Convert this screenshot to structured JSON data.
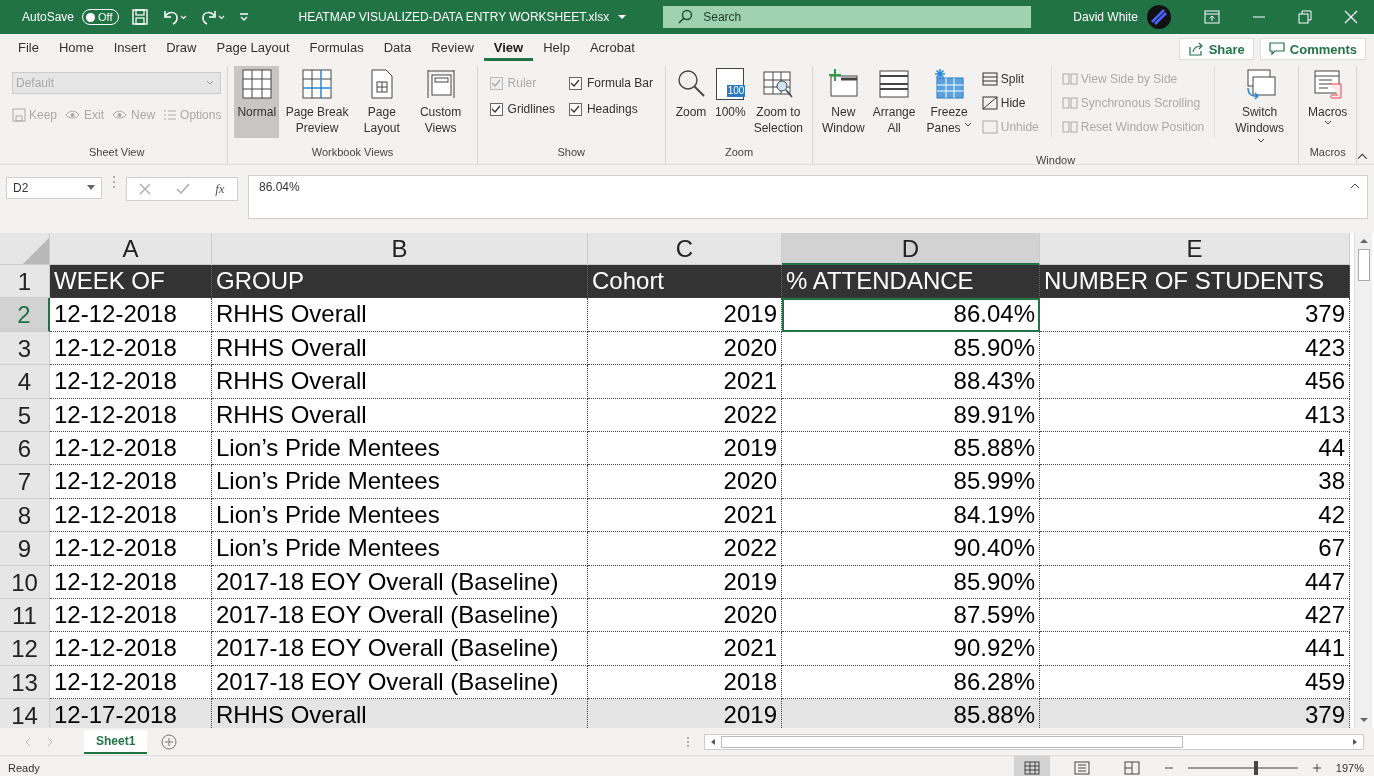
{
  "title_bar": {
    "autosave_label": "AutoSave",
    "autosave_state": "Off",
    "autosave_on": false,
    "document_title": "HEATMAP VISUALIZED-DATA ENTRY WORKSHEET.xlsx",
    "search": {
      "placeholder": "Search"
    },
    "user_name": "David White"
  },
  "menu_tabs": [
    {
      "label": "File",
      "selected": false
    },
    {
      "label": "Home",
      "selected": false
    },
    {
      "label": "Insert",
      "selected": false
    },
    {
      "label": "Draw",
      "selected": false
    },
    {
      "label": "Page Layout",
      "selected": false
    },
    {
      "label": "Formulas",
      "selected": false
    },
    {
      "label": "Data",
      "selected": false
    },
    {
      "label": "Review",
      "selected": false
    },
    {
      "label": "View",
      "selected": true
    },
    {
      "label": "Help",
      "selected": false
    },
    {
      "label": "Acrobat",
      "selected": false
    }
  ],
  "share_button": "Share",
  "comments_button": "Comments",
  "ribbon": {
    "sheet_view": {
      "label": "Sheet View",
      "view_select": {
        "value": "Default",
        "disabled": true
      },
      "buttons": [
        {
          "label": "Keep",
          "disabled": true
        },
        {
          "label": "Exit",
          "disabled": true
        },
        {
          "label": "New",
          "disabled": true
        },
        {
          "label": "Options",
          "disabled": true
        }
      ]
    },
    "workbook_views": {
      "label": "Workbook Views",
      "buttons": [
        {
          "label": "Normal",
          "selected": true
        },
        {
          "label": "Page Break Preview",
          "selected": false
        },
        {
          "label": "Page Layout",
          "selected": false
        },
        {
          "label": "Custom Views",
          "selected": false
        }
      ]
    },
    "show": {
      "label": "Show",
      "checkboxes": [
        {
          "label": "Ruler",
          "checked": true,
          "disabled": true
        },
        {
          "label": "Formula Bar",
          "checked": true,
          "disabled": false
        },
        {
          "label": "Gridlines",
          "checked": true,
          "disabled": false
        },
        {
          "label": "Headings",
          "checked": true,
          "disabled": false
        }
      ]
    },
    "zoom": {
      "label": "Zoom",
      "buttons": [
        "Zoom",
        "100%",
        "Zoom to Selection"
      ],
      "badge": "100"
    },
    "window": {
      "label": "Window",
      "large_buttons": [
        {
          "label": "New Window",
          "dropdown": false
        },
        {
          "label": "Arrange All",
          "dropdown": false
        },
        {
          "label": "Freeze Panes",
          "dropdown": true
        }
      ],
      "small_buttons": [
        {
          "label": "Split",
          "disabled": false
        },
        {
          "label": "Hide",
          "disabled": false
        },
        {
          "label": "Unhide",
          "disabled": true
        }
      ],
      "side_buttons": [
        {
          "label": "View Side by Side",
          "disabled": true
        },
        {
          "label": "Synchronous Scrolling",
          "disabled": true
        },
        {
          "label": "Reset Window Position",
          "disabled": true
        }
      ],
      "switch_button": {
        "label": "Switch Windows",
        "dropdown": true
      }
    },
    "macros": {
      "label": "Macros",
      "button": "Macros"
    }
  },
  "formula_bar": {
    "name_box": "D2",
    "function_button": "fx",
    "value": "86.04%"
  },
  "sheet": {
    "columns": [
      {
        "label": "A",
        "selected": false
      },
      {
        "label": "B",
        "selected": false
      },
      {
        "label": "C",
        "selected": false
      },
      {
        "label": "D",
        "selected": true
      },
      {
        "label": "E",
        "selected": false
      }
    ],
    "rows": [
      {
        "number": "1",
        "selected": false,
        "header": true,
        "shaded": false,
        "cells": [
          "WEEK OF",
          "GROUP",
          "Cohort",
          "% ATTENDANCE",
          "NUMBER OF STUDENTS"
        ]
      },
      {
        "number": "2",
        "selected": true,
        "header": false,
        "shaded": false,
        "cells": [
          "12-12-2018",
          "RHHS Overall",
          "2019",
          "86.04%",
          "379"
        ]
      },
      {
        "number": "3",
        "selected": false,
        "header": false,
        "shaded": false,
        "cells": [
          "12-12-2018",
          "RHHS Overall",
          "2020",
          "85.90%",
          "423"
        ]
      },
      {
        "number": "4",
        "selected": false,
        "header": false,
        "shaded": false,
        "cells": [
          "12-12-2018",
          "RHHS Overall",
          "2021",
          "88.43%",
          "456"
        ]
      },
      {
        "number": "5",
        "selected": false,
        "header": false,
        "shaded": false,
        "cells": [
          "12-12-2018",
          "RHHS Overall",
          "2022",
          "89.91%",
          "413"
        ]
      },
      {
        "number": "6",
        "selected": false,
        "header": false,
        "shaded": false,
        "cells": [
          "12-12-2018",
          "Lion’s Pride Mentees",
          "2019",
          "85.88%",
          "44"
        ]
      },
      {
        "number": "7",
        "selected": false,
        "header": false,
        "shaded": false,
        "cells": [
          "12-12-2018",
          "Lion’s Pride Mentees",
          "2020",
          "85.99%",
          "38"
        ]
      },
      {
        "number": "8",
        "selected": false,
        "header": false,
        "shaded": false,
        "cells": [
          "12-12-2018",
          "Lion’s Pride Mentees",
          "2021",
          "84.19%",
          "42"
        ]
      },
      {
        "number": "9",
        "selected": false,
        "header": false,
        "shaded": false,
        "cells": [
          "12-12-2018",
          "Lion’s Pride Mentees",
          "2022",
          "90.40%",
          "67"
        ]
      },
      {
        "number": "10",
        "selected": false,
        "header": false,
        "shaded": false,
        "cells": [
          "12-12-2018",
          "2017-18 EOY Overall (Baseline)",
          "2019",
          "85.90%",
          "447"
        ]
      },
      {
        "number": "11",
        "selected": false,
        "header": false,
        "shaded": false,
        "cells": [
          "12-12-2018",
          "2017-18 EOY Overall (Baseline)",
          "2020",
          "87.59%",
          "427"
        ]
      },
      {
        "number": "12",
        "selected": false,
        "header": false,
        "shaded": false,
        "cells": [
          "12-12-2018",
          "2017-18 EOY Overall (Baseline)",
          "2021",
          "90.92%",
          "441"
        ]
      },
      {
        "number": "13",
        "selected": false,
        "header": false,
        "shaded": false,
        "cells": [
          "12-12-2018",
          "2017-18 EOY Overall (Baseline)",
          "2018",
          "86.28%",
          "459"
        ]
      },
      {
        "number": "14",
        "selected": false,
        "header": false,
        "shaded": true,
        "cells": [
          "12-17-2018",
          "RHHS Overall",
          "2019",
          "85.88%",
          "379"
        ]
      }
    ]
  },
  "sheet_tabs": [
    {
      "label": "Sheet1",
      "selected": true
    }
  ],
  "status_bar": {
    "status": "Ready",
    "views": [
      {
        "selected": true
      },
      {
        "selected": false
      },
      {
        "selected": false
      }
    ],
    "zoom": {
      "level": 0.62,
      "label": "197%"
    }
  }
}
